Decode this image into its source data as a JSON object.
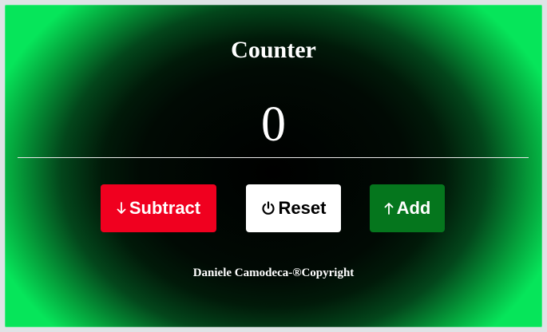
{
  "app": {
    "title": "Counter"
  },
  "counter": {
    "value": "0"
  },
  "buttons": {
    "subtract": {
      "label": "Subtract",
      "icon": "arrow-down-icon",
      "color": "#f0001f"
    },
    "reset": {
      "label": "Reset",
      "icon": "power-icon",
      "color": "#ffffff"
    },
    "add": {
      "label": "Add",
      "icon": "arrow-up-icon",
      "color": "#05761d"
    }
  },
  "footer": {
    "text": "Daniele Camodeca-®Copyright"
  },
  "theme": {
    "background_center": "#000000",
    "background_edge": "#06e55a"
  }
}
